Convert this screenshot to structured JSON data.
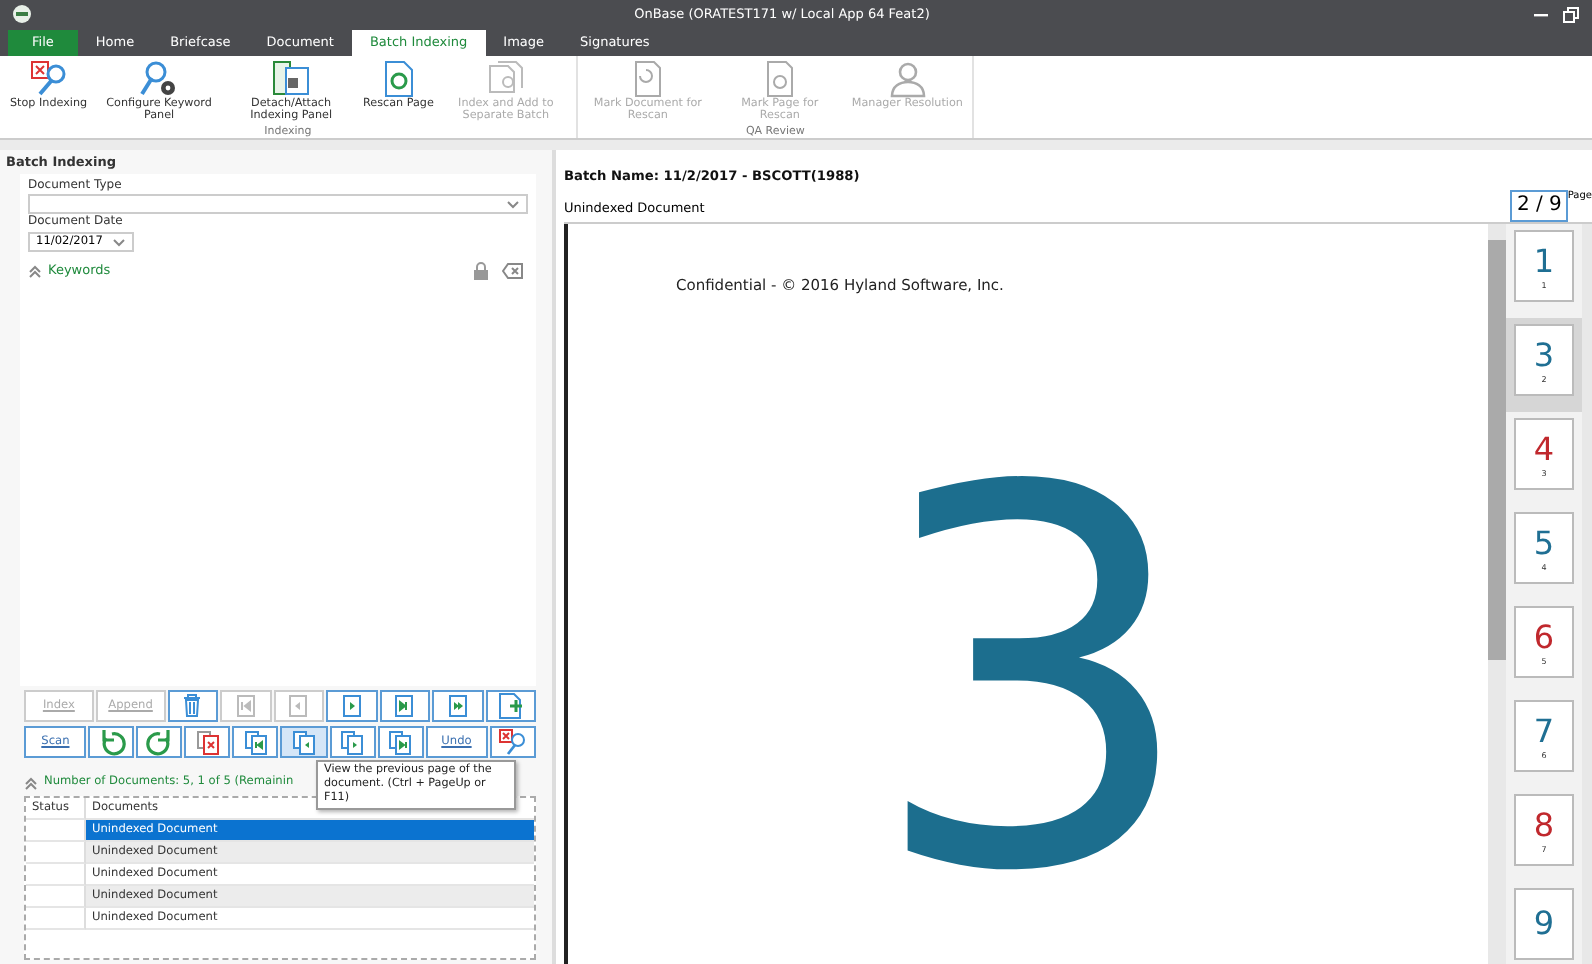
{
  "window": {
    "title": "OnBase (ORATEST171 w/ Local App 64 Feat2)"
  },
  "ribbon_tabs": [
    {
      "label": "File",
      "kind": "file",
      "selected": false
    },
    {
      "label": "Home",
      "kind": "tab",
      "selected": false
    },
    {
      "label": "Briefcase",
      "kind": "tab",
      "selected": false
    },
    {
      "label": "Document",
      "kind": "tab",
      "selected": false
    },
    {
      "label": "Batch Indexing",
      "kind": "tab",
      "selected": true
    },
    {
      "label": "Image",
      "kind": "tab",
      "selected": false
    },
    {
      "label": "Signatures",
      "kind": "tab",
      "selected": false
    }
  ],
  "ribbon_groups": [
    {
      "label": "Indexing",
      "buttons": [
        {
          "label": "Stop Indexing",
          "disabled": false
        },
        {
          "label": "Configure Keyword Panel",
          "disabled": false
        },
        {
          "label": "Detach/Attach Indexing Panel",
          "disabled": false
        },
        {
          "label": "Rescan Page",
          "disabled": false
        },
        {
          "label": "Index and Add to Separate Batch",
          "disabled": true
        }
      ]
    },
    {
      "label": "QA Review",
      "buttons": [
        {
          "label": "Mark Document for Rescan",
          "disabled": true
        },
        {
          "label": "Mark Page for Rescan",
          "disabled": true
        },
        {
          "label": "Manager Resolution",
          "disabled": true
        }
      ]
    }
  ],
  "left_panel": {
    "title": "Batch Indexing",
    "document_type": {
      "label": "Document Type"
    },
    "document_date": {
      "label": "Document Date",
      "value": "11/02/2017"
    },
    "keywords": {
      "label": "Keywords",
      "expanded": true
    },
    "toolbar_rows": [
      [
        {
          "kind": "text",
          "label": "Index",
          "disabled": true,
          "hovered": false
        },
        {
          "kind": "text",
          "label": "Append",
          "disabled": true,
          "hovered": false
        },
        {
          "kind": "icon",
          "disabled": false,
          "hovered": false
        },
        {
          "kind": "icon",
          "disabled": true,
          "hovered": false
        },
        {
          "kind": "icon",
          "disabled": true,
          "hovered": false
        },
        {
          "kind": "icon",
          "disabled": false,
          "hovered": false
        },
        {
          "kind": "icon",
          "disabled": false,
          "hovered": false
        },
        {
          "kind": "icon",
          "disabled": false,
          "hovered": false
        },
        {
          "kind": "icon",
          "disabled": false,
          "hovered": false
        }
      ],
      [
        {
          "kind": "text",
          "label": "Scan",
          "disabled": false,
          "hovered": false
        },
        {
          "kind": "icon",
          "disabled": false,
          "hovered": false
        },
        {
          "kind": "icon",
          "disabled": false,
          "hovered": false
        },
        {
          "kind": "icon",
          "disabled": false,
          "hovered": false
        },
        {
          "kind": "icon",
          "disabled": false,
          "hovered": false
        },
        {
          "kind": "icon",
          "disabled": false,
          "hovered": true
        },
        {
          "kind": "icon",
          "disabled": false,
          "hovered": false
        },
        {
          "kind": "icon",
          "disabled": false,
          "hovered": false
        },
        {
          "kind": "text",
          "label": "Undo",
          "disabled": false,
          "hovered": false
        },
        {
          "kind": "icon",
          "disabled": false,
          "hovered": false
        }
      ]
    ],
    "tooltip": "View the previous page of the document. (Ctrl + PageUp or F11)",
    "documents": {
      "header": "Number of Documents: 5, 1 of 5 (Remainin",
      "expanded": true,
      "columns": [
        "Status",
        "Documents"
      ],
      "rows": [
        {
          "status": "",
          "name": "Unindexed Document",
          "selected": true
        },
        {
          "status": "",
          "name": "Unindexed Document",
          "selected": false
        },
        {
          "status": "",
          "name": "Unindexed Document",
          "selected": false
        },
        {
          "status": "",
          "name": "Unindexed Document",
          "selected": false
        },
        {
          "status": "",
          "name": "Unindexed Document",
          "selected": false
        }
      ]
    }
  },
  "viewer": {
    "batch_name": "Batch Name: 11/2/2017 - BSCOTT(1988)",
    "document_title": "Unindexed Document",
    "page_counter": "2 / 9",
    "page_label": "Page",
    "page_footer": "Confidential - © 2016 Hyland Software, Inc.",
    "page_number": "3",
    "thumbnails": [
      {
        "digit": "1",
        "index": "1",
        "color": "#1f6f93",
        "selected": false
      },
      {
        "digit": "3",
        "index": "2",
        "color": "#1f6f93",
        "selected": true
      },
      {
        "digit": "4",
        "index": "3",
        "color": "#c0282d",
        "selected": false
      },
      {
        "digit": "5",
        "index": "4",
        "color": "#1f6f93",
        "selected": false
      },
      {
        "digit": "6",
        "index": "5",
        "color": "#c0282d",
        "selected": false
      },
      {
        "digit": "7",
        "index": "6",
        "color": "#1f6f93",
        "selected": false
      },
      {
        "digit": "8",
        "index": "7",
        "color": "#c0282d",
        "selected": false
      },
      {
        "digit": "9",
        "color": "#1f6f93",
        "selected": false
      }
    ]
  }
}
